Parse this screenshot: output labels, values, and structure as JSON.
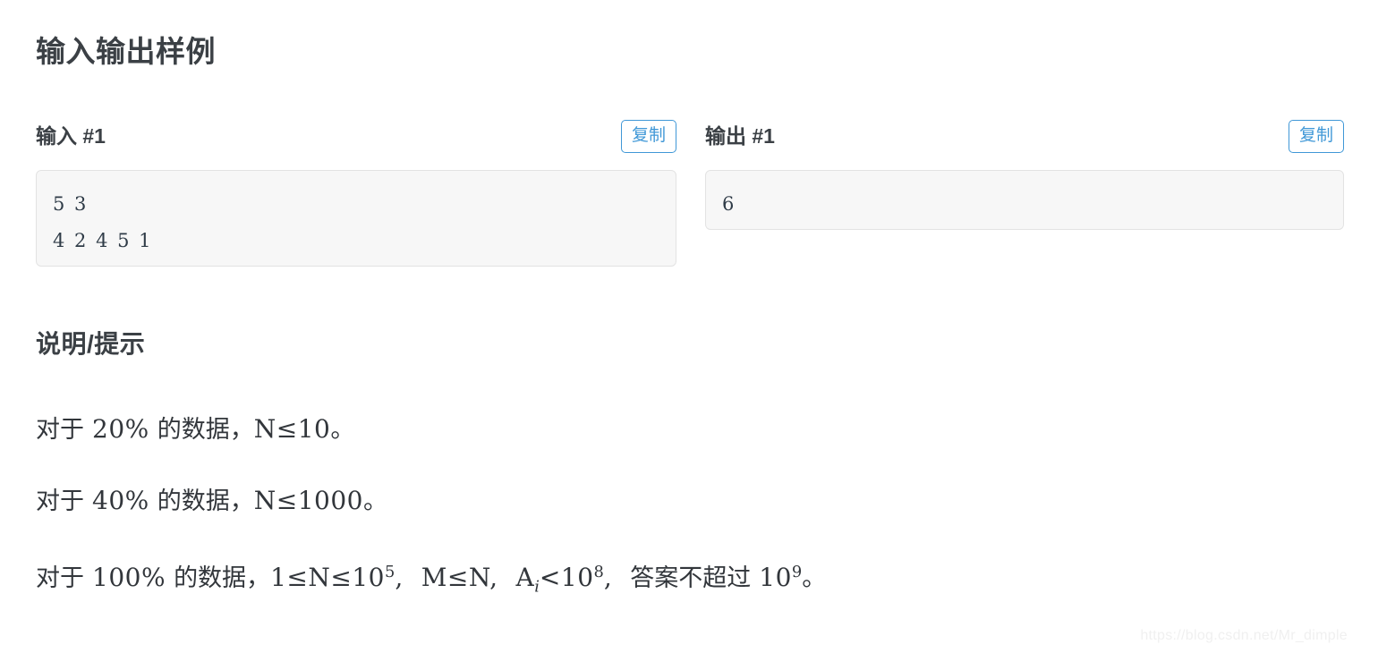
{
  "page": {
    "title": "输入输出样例",
    "hints_title": "说明/提示",
    "watermark": "https://blog.csdn.net/Mr_dimple",
    "accent_color": "#4098d7",
    "code_bg_color": "#f7f7f7",
    "text_color": "#3b4045"
  },
  "samples": [
    {
      "label": "输入 #1",
      "copy_label": "复制",
      "code": "5 3\n4 2 4 5 1",
      "lines": [
        "5 3",
        "4 2 4 5 1"
      ]
    },
    {
      "label": "输出 #1",
      "copy_label": "复制",
      "code": "6",
      "lines": [
        "6"
      ]
    }
  ],
  "hints": [
    {
      "id": "hint-20",
      "text": "对于 20% 的数据，N ≤ 10。",
      "parts": {
        "lead": "对于",
        "percent": "20%",
        "middle": "的数据，",
        "var1": "N",
        "op1": "≤",
        "value1": "10",
        "period": "。"
      }
    },
    {
      "id": "hint-40",
      "text": "对于 40% 的数据，N ≤ 1000。",
      "parts": {
        "lead": "对于",
        "percent": "40%",
        "middle": "的数据，",
        "var1": "N",
        "op1": "≤",
        "value1": "1000",
        "period": "。"
      }
    },
    {
      "id": "hint-100",
      "text": "对于 100% 的数据，1 ≤ N ≤ 10^5, M ≤ N, A_i < 10^8, 答案不超过 10^9。",
      "parts": {
        "lead": "对于",
        "percent": "100%",
        "middle": "的数据，",
        "one": "1",
        "op1": "≤",
        "var1": "N",
        "op2": "≤",
        "base1": "10",
        "exp1": "5",
        "comma1": ",",
        "var2": "M",
        "op3": "≤",
        "var3": "N",
        "comma2": ",",
        "var4": "A",
        "sub4": "i",
        "op4": "<",
        "base2": "10",
        "exp2": "8",
        "comma3": ",",
        "tail": "答案不超过",
        "base3": "10",
        "exp3": "9",
        "period": "。"
      }
    }
  ]
}
